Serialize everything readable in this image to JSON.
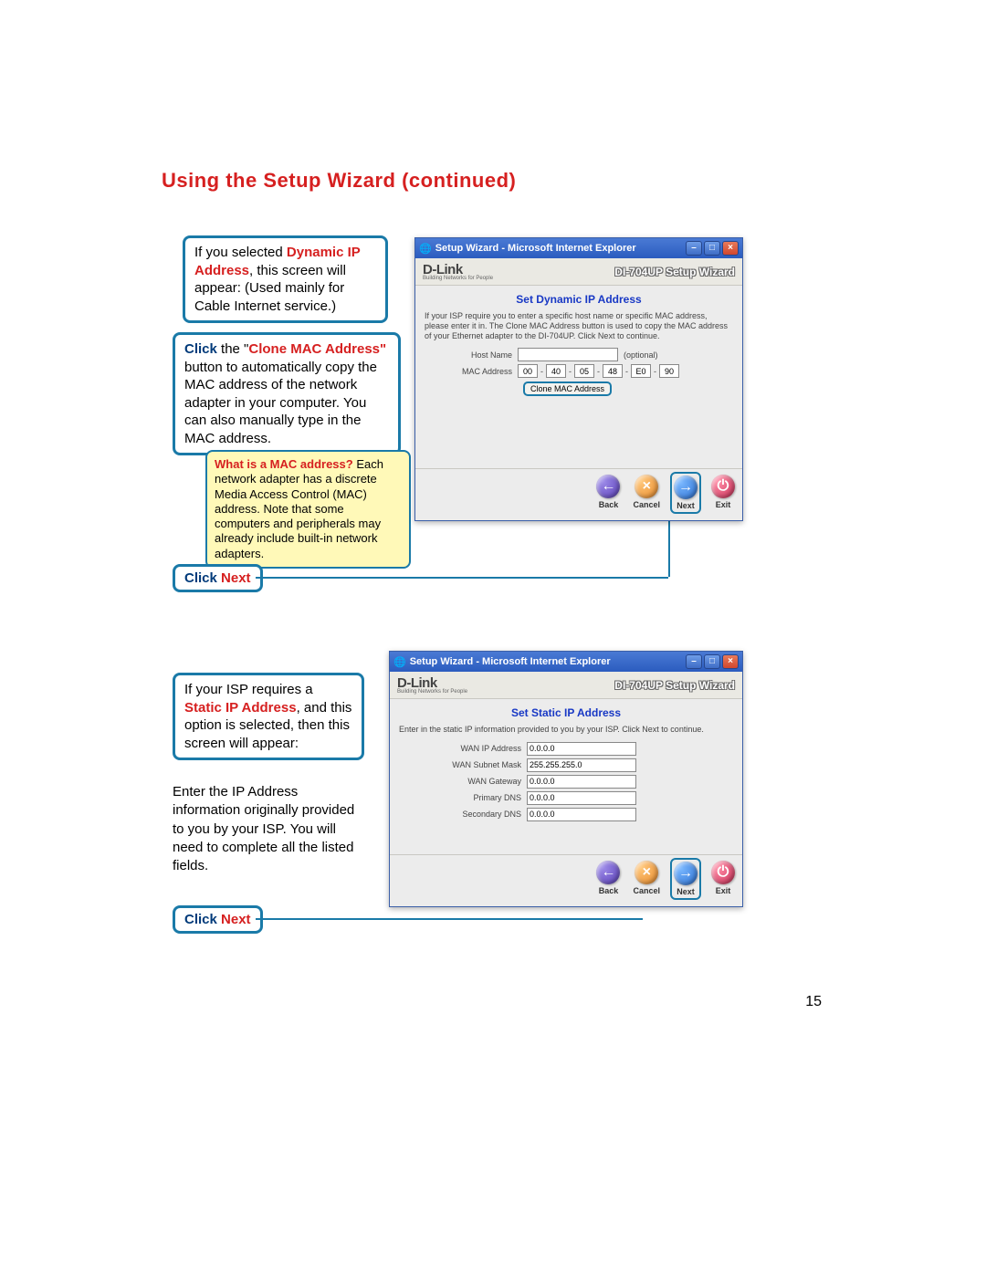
{
  "title": "Using the Setup Wizard (continued)",
  "page_number": "15",
  "section1": {
    "intro_pre": "If you selected ",
    "intro_red": "Dynamic IP Address",
    "intro_post": ", this screen will appear: (Used mainly for Cable Internet service.)",
    "callout_click": "Click",
    "callout_the": " the \"",
    "callout_red": "Clone MAC Address\"",
    "callout_body": " button to automatically copy the MAC address of the network adapter in your computer. You can also manually type in the MAC address.",
    "note_red": "What is a MAC address?",
    "note_body": " Each network adapter has a discrete Media Access Control (MAC) address. Note that some computers and peripherals may already include built-in network adapters.",
    "click_next_c": "Click ",
    "click_next_n": "Next"
  },
  "section2": {
    "intro_pre": "If your ISP requires a ",
    "intro_red": "Static IP Address",
    "intro_post": ", and this option is selected, then this screen will appear:",
    "body2": "Enter the IP Address information originally provided to you by your ISP. You will need to complete all the listed fields.",
    "click_next_c": "Click ",
    "click_next_n": "Next"
  },
  "win1": {
    "title": "Setup Wizard - Microsoft Internet Explorer",
    "brand": "D-Link",
    "brand_sub": "Building Networks for People",
    "wizname": "DI-704UP Setup Wizard",
    "section": "Set Dynamic IP Address",
    "desc": "If your ISP require you to enter a specific host name or specific MAC address, please enter it in. The Clone MAC Address button is used to copy the MAC address of your Ethernet adapter to the DI-704UP. Click Next to continue.",
    "hostname_lbl": "Host Name",
    "hostname_opt": "(optional)",
    "mac_lbl": "MAC Address",
    "mac": [
      "00",
      "40",
      "05",
      "48",
      "E0",
      "90"
    ],
    "clone_btn": "Clone MAC Address",
    "btn_back": "Back",
    "btn_cancel": "Cancel",
    "btn_next": "Next",
    "btn_exit": "Exit"
  },
  "win2": {
    "title": "Setup Wizard - Microsoft Internet Explorer",
    "brand": "D-Link",
    "brand_sub": "Building Networks for People",
    "wizname": "DI-704UP Setup Wizard",
    "section": "Set Static IP Address",
    "desc": "Enter in the static IP information provided to you by your ISP. Click Next to continue.",
    "f1_lbl": "WAN IP Address",
    "f1_val": "0.0.0.0",
    "f2_lbl": "WAN Subnet Mask",
    "f2_val": "255.255.255.0",
    "f3_lbl": "WAN Gateway",
    "f3_val": "0.0.0.0",
    "f4_lbl": "Primary DNS",
    "f4_val": "0.0.0.0",
    "f5_lbl": "Secondary DNS",
    "f5_val": "0.0.0.0",
    "btn_back": "Back",
    "btn_cancel": "Cancel",
    "btn_next": "Next",
    "btn_exit": "Exit"
  }
}
